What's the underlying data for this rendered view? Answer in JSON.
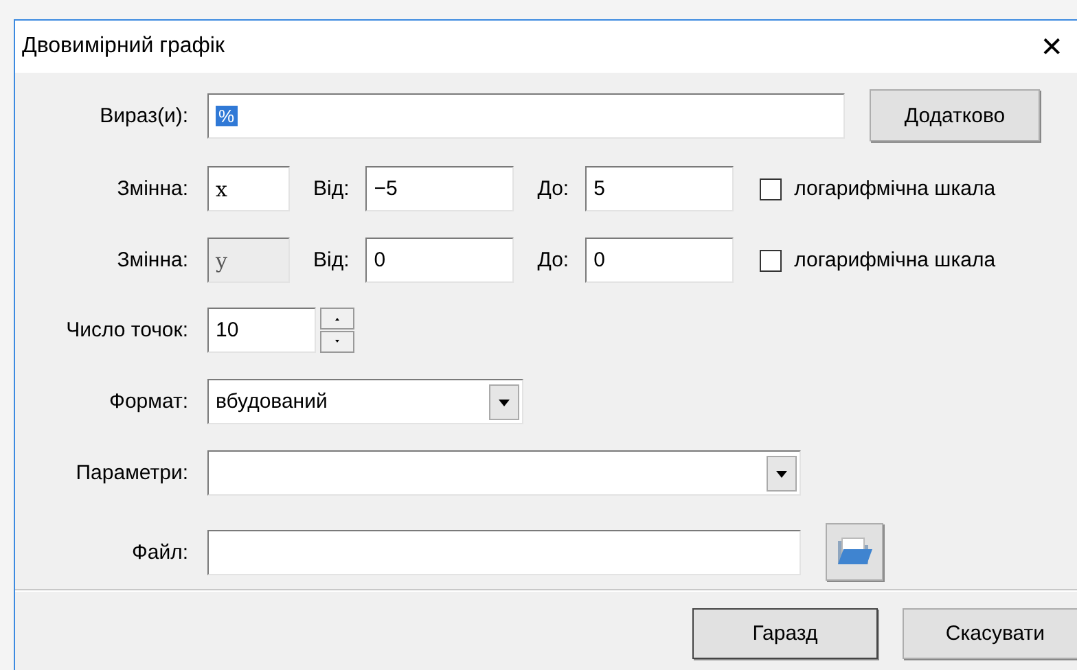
{
  "window": {
    "title": "Двовимірний графік",
    "close": "✕"
  },
  "expression": {
    "label": "Вираз(и):",
    "value": "%",
    "highlighted": true,
    "button": "Додатково"
  },
  "variables": [
    {
      "label": "Змінна:",
      "value": "x",
      "disabled": false,
      "from_label": "Від:",
      "from": "−5",
      "to_label": "До:",
      "to": "5",
      "log_label": "логарифмічна шкала",
      "log_checked": false
    },
    {
      "label": "Змінна:",
      "value": "y",
      "disabled": true,
      "from_label": "Від:",
      "from": "0",
      "to_label": "До:",
      "to": "0",
      "log_label": "логарифмічна шкала",
      "log_checked": false
    }
  ],
  "points": {
    "label": "Число точок:",
    "value": "10"
  },
  "format": {
    "label": "Формат:",
    "value": "вбудований"
  },
  "parameters": {
    "label": "Параметри:"
  },
  "file": {
    "label": "Файл:"
  },
  "buttons": [
    "Гаразд",
    "Скасувати"
  ]
}
